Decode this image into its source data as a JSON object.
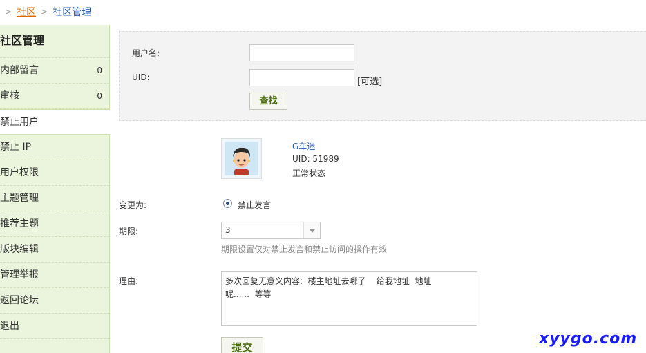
{
  "breadcrumb": {
    "home": "社区",
    "current": "社区管理"
  },
  "sidebar": {
    "title": "社区管理",
    "items": [
      {
        "label": "内部留言",
        "count": "0"
      },
      {
        "label": "审核",
        "count": "0"
      },
      {
        "label": "禁止用户",
        "count": ""
      },
      {
        "label": "禁止 IP",
        "count": ""
      },
      {
        "label": "用户权限",
        "count": ""
      },
      {
        "label": "主题管理",
        "count": ""
      },
      {
        "label": "推荐主题",
        "count": ""
      },
      {
        "label": "版块编辑",
        "count": ""
      },
      {
        "label": "管理举报",
        "count": ""
      },
      {
        "label": "返回论坛",
        "count": ""
      },
      {
        "label": "退出",
        "count": ""
      }
    ],
    "active_index": 2
  },
  "search": {
    "username_label": "用户名:",
    "username_value": "",
    "uid_label": "UID:",
    "uid_value": "",
    "uid_hint": "[可选]",
    "search_button": "查找"
  },
  "user": {
    "name": "G车迷",
    "uid": "UID: 51989",
    "status": "正常状态"
  },
  "form": {
    "change_label": "变更为:",
    "change_option": "禁止发言",
    "period_label": "期限:",
    "period_value": "3",
    "period_note": "期限设置仅对禁止发言和禁止访问的操作有效",
    "reason_label": "理由:",
    "reason_value": "多次回复无意义内容:  楼主地址去哪了    给我地址  地址\n呢......  等等",
    "submit_button": "提交"
  },
  "watermark": "xyygo.com",
  "colors": {
    "sidebar_bg": "#ebf4dc",
    "link": "#2a5db0",
    "breadcrumb_home": "#e06c00",
    "button_text": "#4b6e10",
    "watermark": "#1a1aff"
  }
}
